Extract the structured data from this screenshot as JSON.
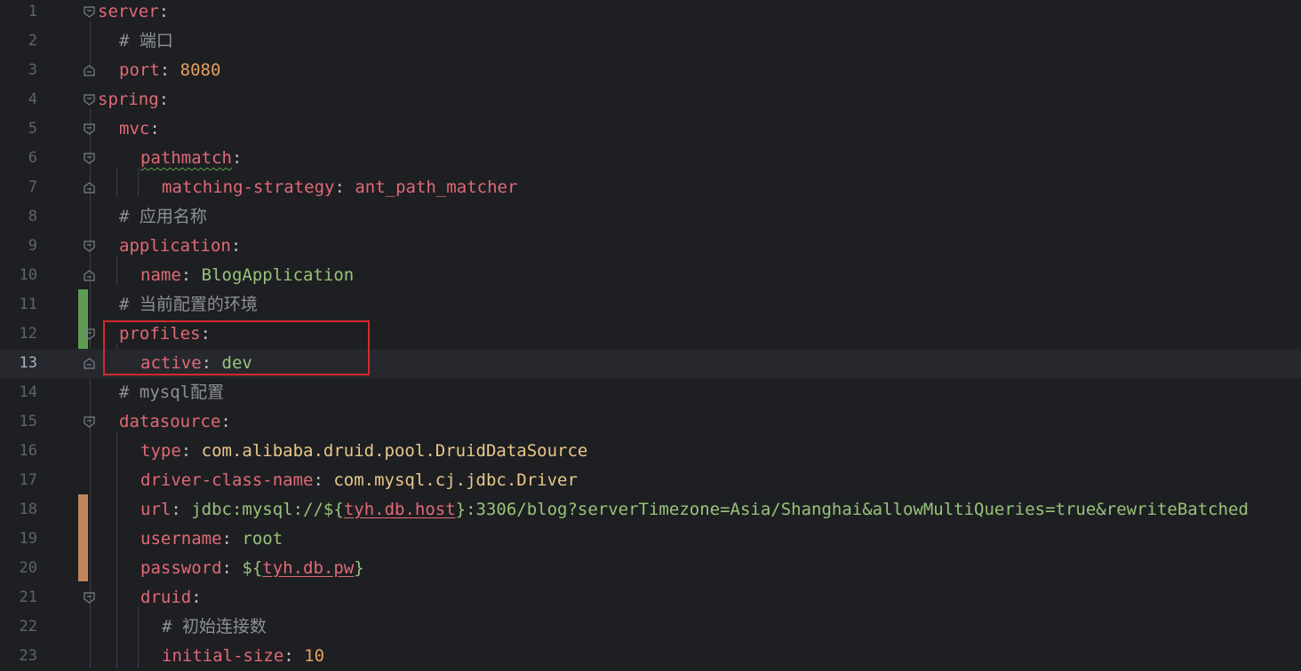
{
  "editor": {
    "lines": [
      {
        "no": "1",
        "key": "server",
        "colon": ":"
      },
      {
        "no": "2",
        "comment": "# 端口"
      },
      {
        "no": "3",
        "key": "port",
        "colon": ": ",
        "value": "8080"
      },
      {
        "no": "4",
        "key": "spring",
        "colon": ":"
      },
      {
        "no": "5",
        "key": "mvc",
        "colon": ":"
      },
      {
        "no": "6",
        "key": "pathmatch",
        "colon": ":"
      },
      {
        "no": "7",
        "key": "matching-strategy",
        "colon": ": ",
        "value": "ant_path_matcher"
      },
      {
        "no": "8",
        "comment": "# 应用名称"
      },
      {
        "no": "9",
        "key": "application",
        "colon": ":"
      },
      {
        "no": "10",
        "key": "name",
        "colon": ": ",
        "value": "BlogApplication"
      },
      {
        "no": "11",
        "comment": "# 当前配置的环境"
      },
      {
        "no": "12",
        "key": "profiles",
        "colon": ":"
      },
      {
        "no": "13",
        "key": "active",
        "colon": ": ",
        "value": "dev"
      },
      {
        "no": "14",
        "comment": "# mysql配置"
      },
      {
        "no": "15",
        "key": "datasource",
        "colon": ":"
      },
      {
        "no": "16",
        "key": "type",
        "colon": ": ",
        "value": "com.alibaba.druid.pool.DruidDataSource"
      },
      {
        "no": "17",
        "key": "driver-class-name",
        "colon": ": ",
        "value": "com.mysql.cj.jdbc.Driver"
      },
      {
        "no": "18",
        "key": "url",
        "colon": ": ",
        "value_pre": "jdbc:mysql://${",
        "value_ref": "tyh.db.host",
        "value_post": "}:3306/blog?serverTimezone=Asia/Shanghai&allowMultiQueries=true&rewriteBatched"
      },
      {
        "no": "19",
        "key": "username",
        "colon": ": ",
        "value": "root"
      },
      {
        "no": "20",
        "key": "password",
        "colon": ": ",
        "value_pre": "${",
        "value_ref": "tyh.db.pw",
        "value_post": "}"
      },
      {
        "no": "21",
        "key": "druid",
        "colon": ":"
      },
      {
        "no": "22",
        "comment": "# 初始连接数"
      },
      {
        "no": "23",
        "key": "initial-size",
        "colon": ": ",
        "value": "10"
      }
    ]
  },
  "colors": {
    "background": "#1e1f22",
    "key": "#e06a77",
    "number": "#e3a05e",
    "string": "#98c379",
    "comment": "#8c8f96",
    "added_marker": "#5e9c53",
    "modified_marker": "#c2865a",
    "highlight_box": "#d42a2a"
  },
  "icons": [
    "fold-start-icon",
    "fold-end-icon"
  ]
}
